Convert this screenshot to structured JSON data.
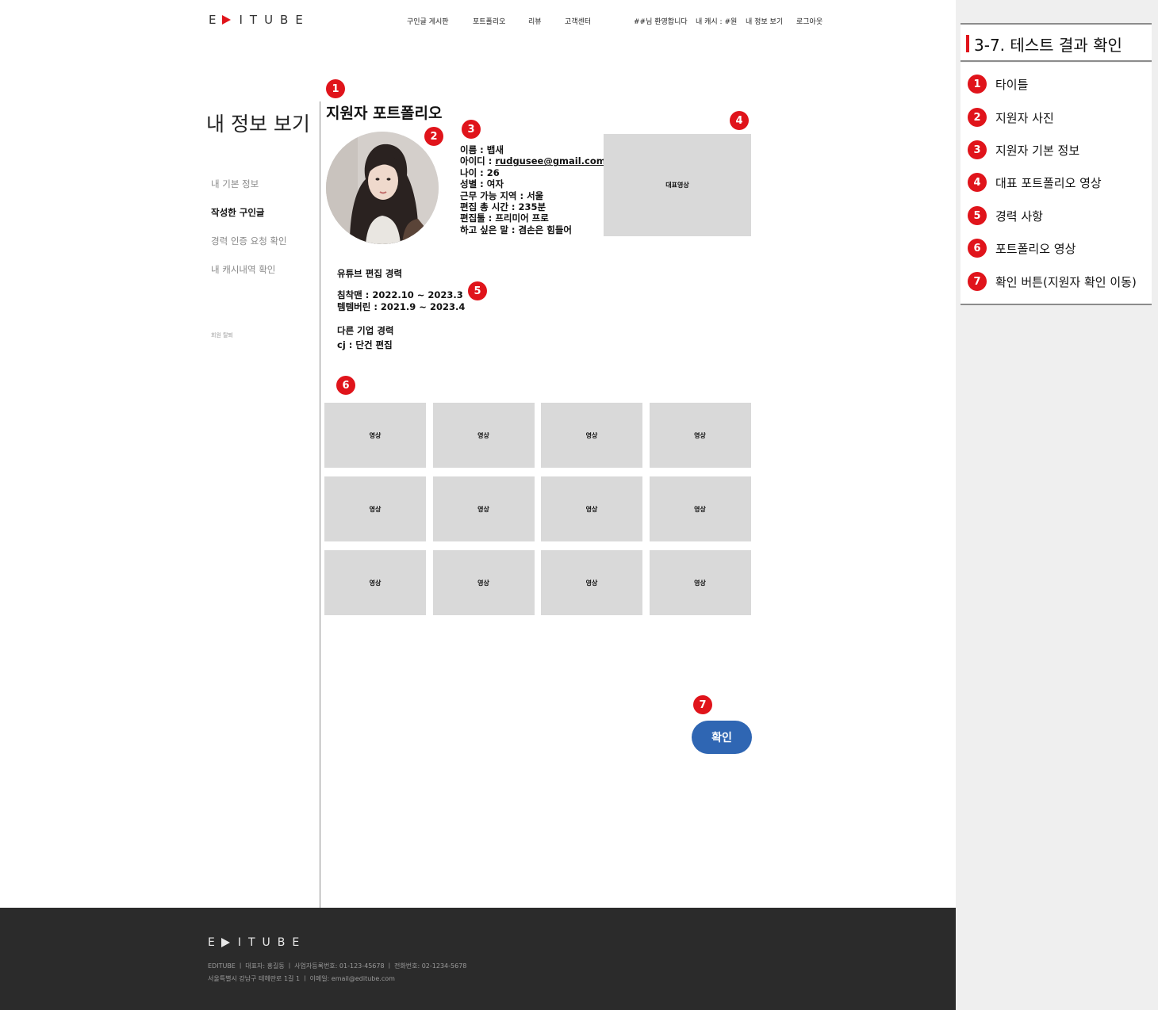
{
  "header": {
    "logo_left": "E",
    "logo_right": "ITUBE",
    "nav": [
      "구인글 게시판",
      "포트폴리오",
      "리뷰",
      "고객센터"
    ],
    "welcome": "##님 환영합니다",
    "cash": "내 캐시 : #원",
    "my_info": "내 정보 보기",
    "logout": "로그아웃"
  },
  "sidebar": {
    "heading": "내 정보 보기",
    "items": [
      {
        "label": "내 기본 정보",
        "active": false
      },
      {
        "label": "작성한 구인글",
        "active": true
      },
      {
        "label": "경력 인증 요청 확인",
        "active": false
      },
      {
        "label": "내 캐시내역 확인",
        "active": false
      }
    ],
    "withdraw": "회원 탈퇴"
  },
  "portfolio": {
    "title": "지원자 포트폴리오",
    "info": {
      "name": "이름 : 뱁새",
      "id_label": "아이디 : ",
      "id_value": "rudgusee@gmail.com",
      "age": "나이 : 26",
      "gender": "성별 : 여자",
      "region": "근무 가능 지역  : 서울",
      "total_time": "편집 총 시간  : 235분",
      "tool": "편집툴  : 프리미어 프로",
      "message": "하고 싶은 말  : 겸손은 힘들어"
    },
    "main_video_label": "대표영상",
    "youtube_career_heading": "유튜브 편집 경력",
    "youtube_career": [
      "침착맨 : 2022.10 ~ 2023.3",
      "템템버린 : 2021.9 ~ 2023.4"
    ],
    "other_career_heading": "다른 기업 경력",
    "other_career": [
      "cj : 단건 편집"
    ],
    "video_label": "영상",
    "video_count": 12,
    "confirm_label": "확인"
  },
  "badges": [
    "1",
    "2",
    "3",
    "4",
    "5",
    "6",
    "7"
  ],
  "footer": {
    "logo_left": "E",
    "logo_right": "ITUBE",
    "line1": "EDITUBE   ㅣ 대표자: 홍길동   ㅣ 사업자등록번호: 01-123-45678     ㅣ 전화번호: 02-1234-5678",
    "line2": "서울특별시 강남구 테헤란로 1길 1  ㅣ 이메일: email@editube.com"
  },
  "side_panel": {
    "title": "3-7. 테스트 결과 확인",
    "items": [
      {
        "num": "1",
        "label": "타이틀"
      },
      {
        "num": "2",
        "label": "지원자 사진"
      },
      {
        "num": "3",
        "label": "지원자 기본 정보"
      },
      {
        "num": "4",
        "label": "대표 포트폴리오 영상"
      },
      {
        "num": "5",
        "label": "경력 사항"
      },
      {
        "num": "6",
        "label": "포트폴리오 영상"
      },
      {
        "num": "7",
        "label": "확인 버튼(지원자 확인 이동)"
      }
    ]
  },
  "colors": {
    "accent_red": "#e0141b",
    "button_blue": "#2f66b3",
    "placeholder_gray": "#d9d9d9",
    "footer_bg": "#2b2b2b"
  }
}
